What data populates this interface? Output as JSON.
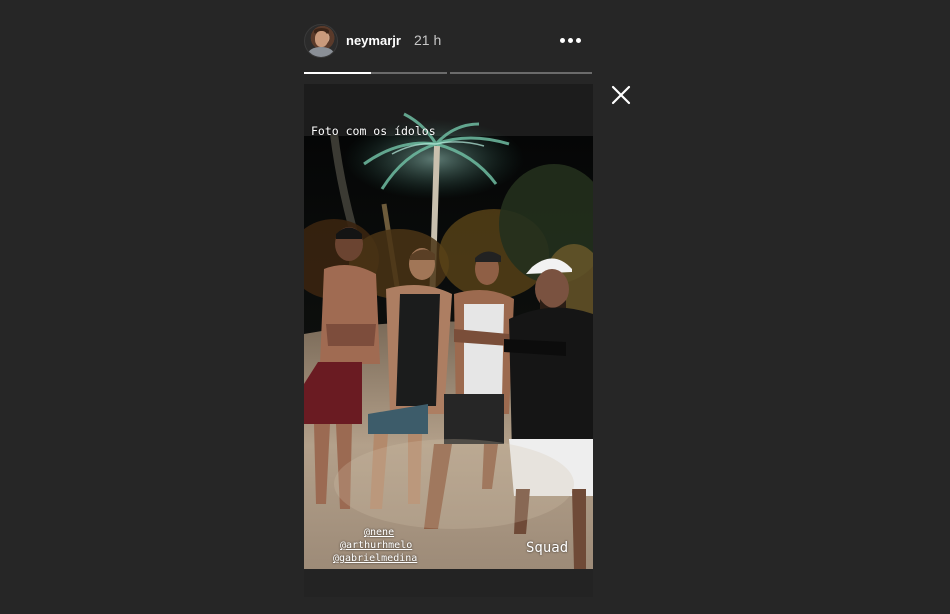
{
  "header": {
    "username": "neymarjr",
    "time": "21 h"
  },
  "icons": {
    "avatar": "profile-avatar",
    "more": "more-options-icon",
    "close": "close-icon"
  },
  "progress": {
    "segments": [
      {
        "fill": 0.47
      },
      {
        "fill": 0.0
      }
    ]
  },
  "story": {
    "caption": "Foto com os ídolos",
    "mentions": [
      "@nene",
      "@arthurhmelo",
      "@gabrielmedina"
    ],
    "sticker_text": "Squad"
  },
  "colors": {
    "background": "#262626",
    "text": "#ffffff",
    "muted": "#c7c7c7"
  }
}
